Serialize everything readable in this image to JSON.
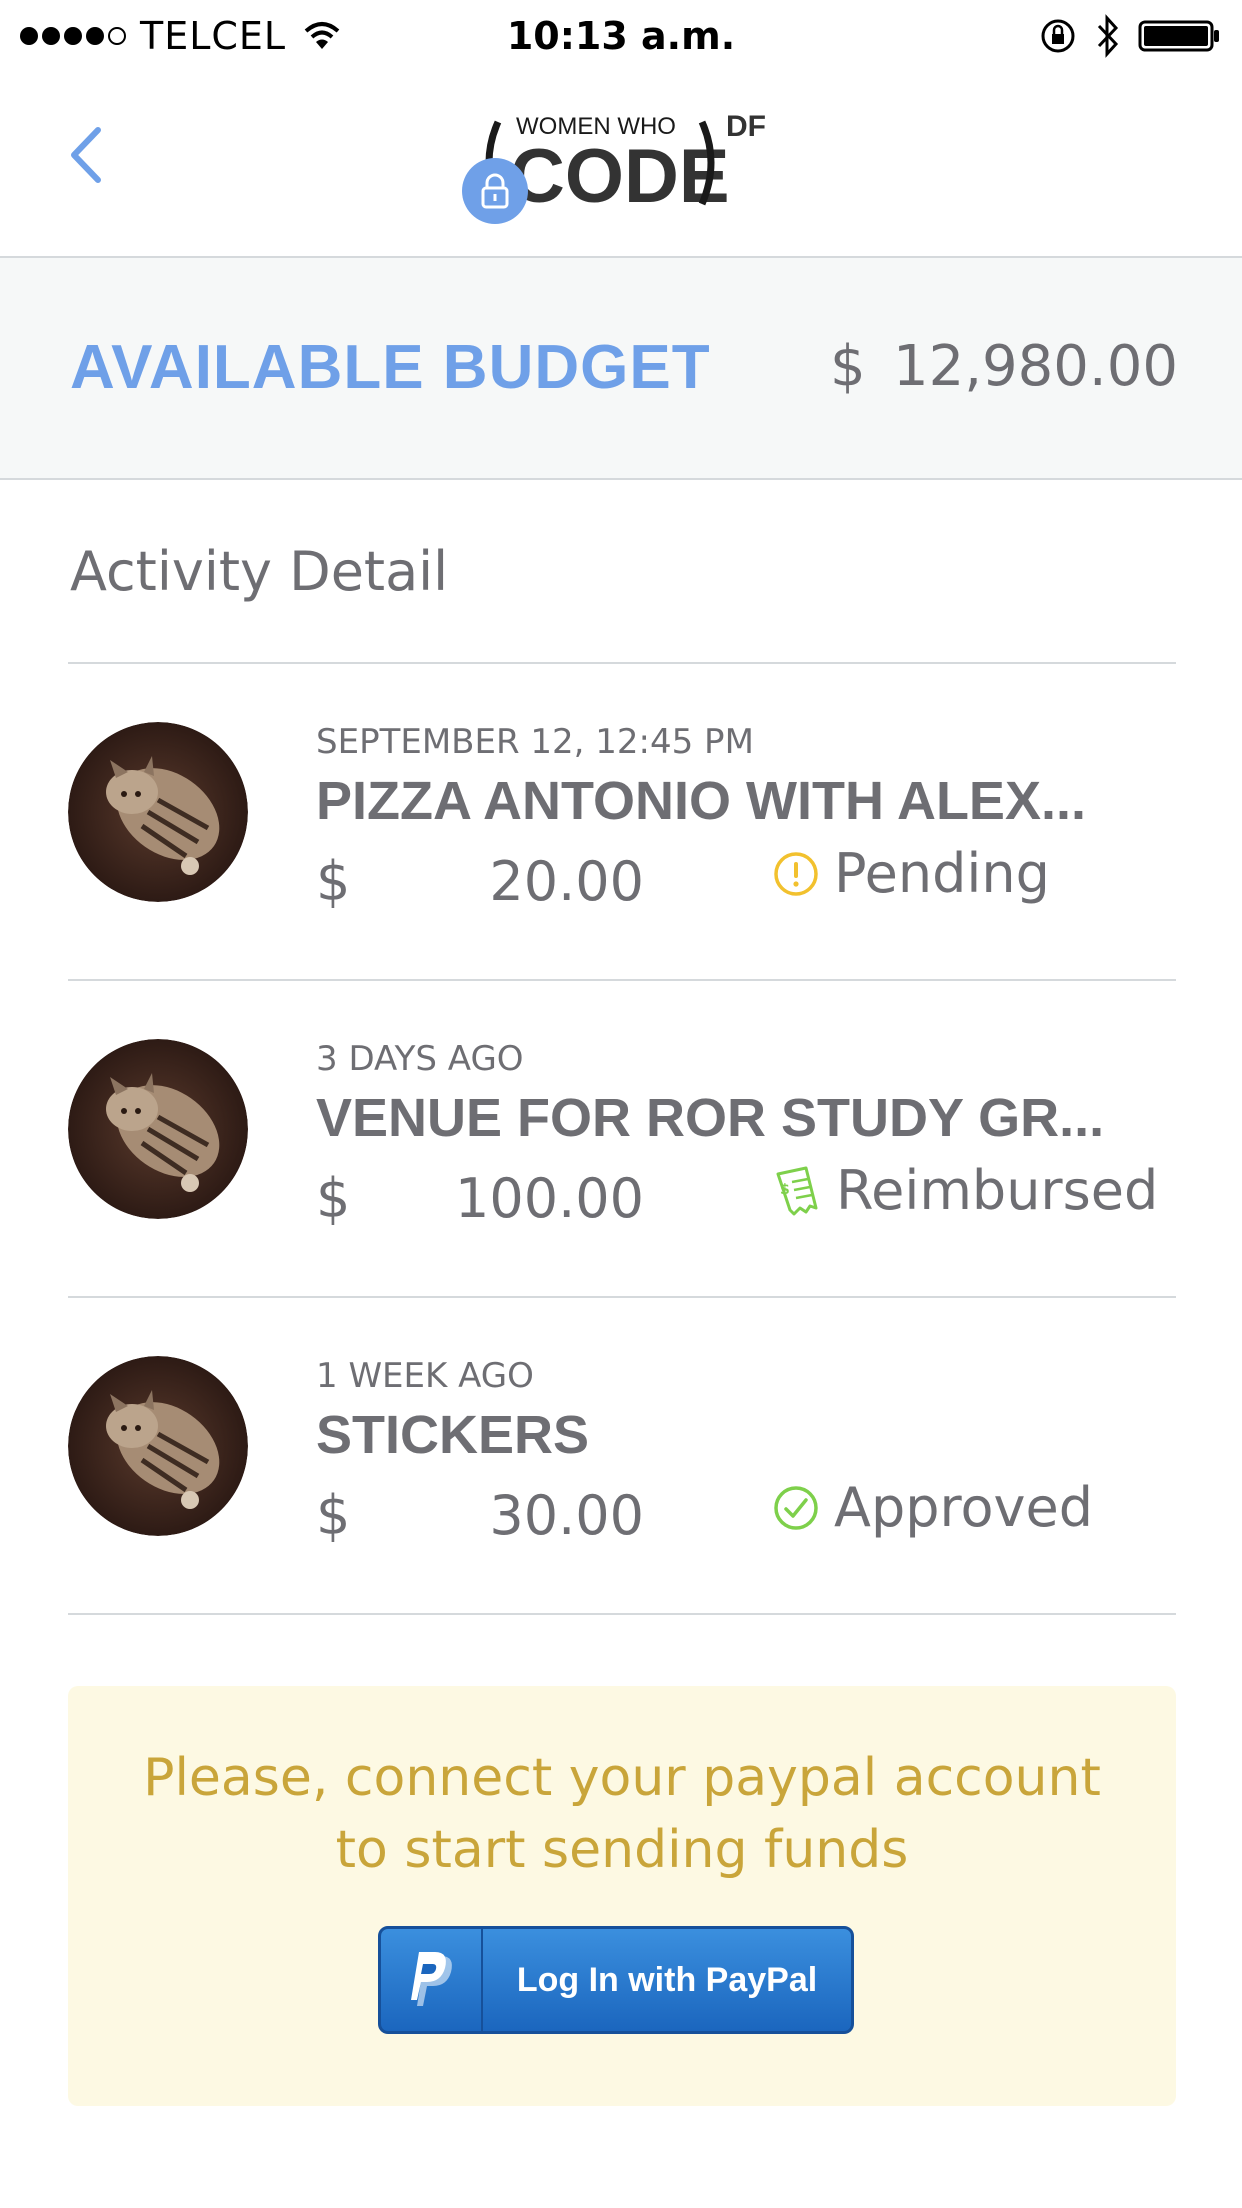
{
  "status_bar": {
    "carrier": "TELCEL",
    "time": "10:13 a.m."
  },
  "header": {
    "logo_top": "WOMEN WHO",
    "logo_main": "CODE",
    "logo_suffix": "DF"
  },
  "budget": {
    "label": "AVAILABLE BUDGET",
    "currency": "$",
    "amount": "12,980.00"
  },
  "activity": {
    "title": "Activity Detail",
    "items": [
      {
        "date": "SEPTEMBER 12, 12:45 PM",
        "title": "PIZZA ANTONIO WITH ALEX...",
        "currency": "$",
        "amount": "20.00",
        "status": "Pending",
        "status_icon": "pending-icon",
        "status_color": "#f2c12e"
      },
      {
        "date": "3 DAYS AGO",
        "title": "VENUE FOR ROR STUDY GR...",
        "currency": "$",
        "amount": "100.00",
        "status": "Reimbursed",
        "status_icon": "receipt-icon",
        "status_color": "#7ed04b"
      },
      {
        "date": "1 WEEK AGO",
        "title": "STICKERS",
        "currency": "$",
        "amount": "30.00",
        "status": "Approved",
        "status_icon": "approved-icon",
        "status_color": "#7ed04b"
      }
    ]
  },
  "notice": {
    "text_line1": "Please, connect your paypal account",
    "text_line2": "to start sending funds",
    "button_label": "Log In with PayPal"
  },
  "colors": {
    "accent": "#6fa0e8",
    "text": "#6e6e73",
    "notice_bg": "#fdf9e3",
    "notice_text": "#c9a53a",
    "paypal_blue": "#1b66be"
  }
}
